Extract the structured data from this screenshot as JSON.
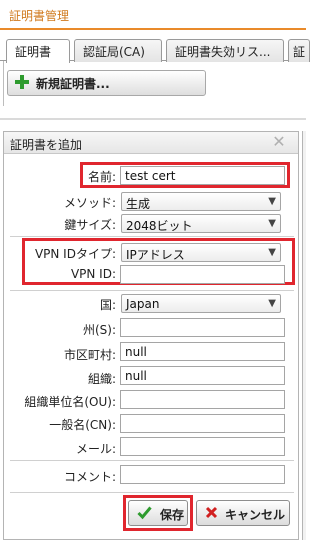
{
  "page": {
    "title": "証明書管理"
  },
  "tabs": [
    {
      "label": "証明書",
      "active": true
    },
    {
      "label": "認証局(CA)"
    },
    {
      "label": "証明書失効リス..."
    },
    {
      "label": "証"
    }
  ],
  "toolbar": {
    "new_cert_label": "新規証明書..."
  },
  "dialog": {
    "title": "証明書を追加",
    "fields": {
      "name": {
        "label": "名前:",
        "value": "test cert"
      },
      "method": {
        "label": "メソッド:",
        "value": "生成"
      },
      "key_size": {
        "label": "鍵サイズ:",
        "value": "2048ビット"
      },
      "vpn_id_type": {
        "label": "VPN IDタイプ:",
        "value": "IPアドレス"
      },
      "vpn_id": {
        "label": "VPN ID:",
        "value": ""
      },
      "country": {
        "label": "国:",
        "value": "Japan"
      },
      "state": {
        "label": "州(S):",
        "value": ""
      },
      "city": {
        "label": "市区町村:",
        "value": "null"
      },
      "org": {
        "label": "組織:",
        "value": "null"
      },
      "org_unit": {
        "label": "組織単位名(OU):",
        "value": ""
      },
      "common_name": {
        "label": "一般名(CN):",
        "value": ""
      },
      "email": {
        "label": "メール:",
        "value": ""
      },
      "comment": {
        "label": "コメント:",
        "value": ""
      }
    },
    "buttons": {
      "save": "保存",
      "cancel": "キャンセル"
    }
  },
  "colors": {
    "accent": "#e98a2a",
    "highlight": "#e0262e",
    "add": "#2e9b2e",
    "cancel": "#d12020"
  },
  "icons": [
    "plus-icon",
    "close-icon",
    "chevron-down-icon",
    "checkmark-icon",
    "x-icon"
  ]
}
